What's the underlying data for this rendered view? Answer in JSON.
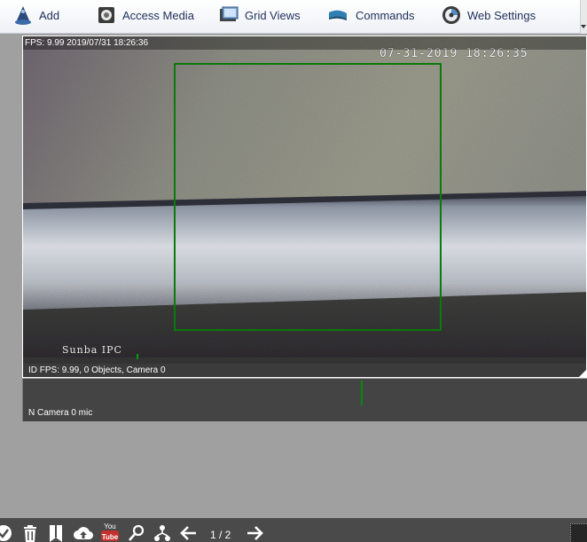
{
  "toolbar": {
    "items": [
      {
        "label": "Add",
        "icon": "add-icon"
      },
      {
        "label": "Access Media",
        "icon": "access-media-icon"
      },
      {
        "label": "Grid Views",
        "icon": "grid-views-icon"
      },
      {
        "label": "Commands",
        "icon": "commands-icon"
      },
      {
        "label": "Web Settings",
        "icon": "web-settings-icon"
      }
    ]
  },
  "camera": {
    "header": "FPS: 9.99 2019/07/31 18:26:36",
    "osd_timestamp": "07-31-2019 18:26:35",
    "osd_name": "Sunba IPC",
    "status": "ID  FPS: 9.99, 0 Objects, Camera 0"
  },
  "mic": {
    "label": "N  Camera 0 mic"
  },
  "footer": {
    "page_indicator": "1 / 2",
    "buttons": [
      "check-icon",
      "trash-icon",
      "bookmark-icon",
      "cloud-upload-icon",
      "youtube-icon",
      "search-icon",
      "share-icon",
      "arrow-left-icon",
      "arrow-right-icon"
    ]
  },
  "colors": {
    "toolbar_text": "#1f2f5a",
    "detection_box": "#0a7a0a",
    "bottom_bar": "#4a4a4a",
    "app_background": "#a0a0a0"
  }
}
